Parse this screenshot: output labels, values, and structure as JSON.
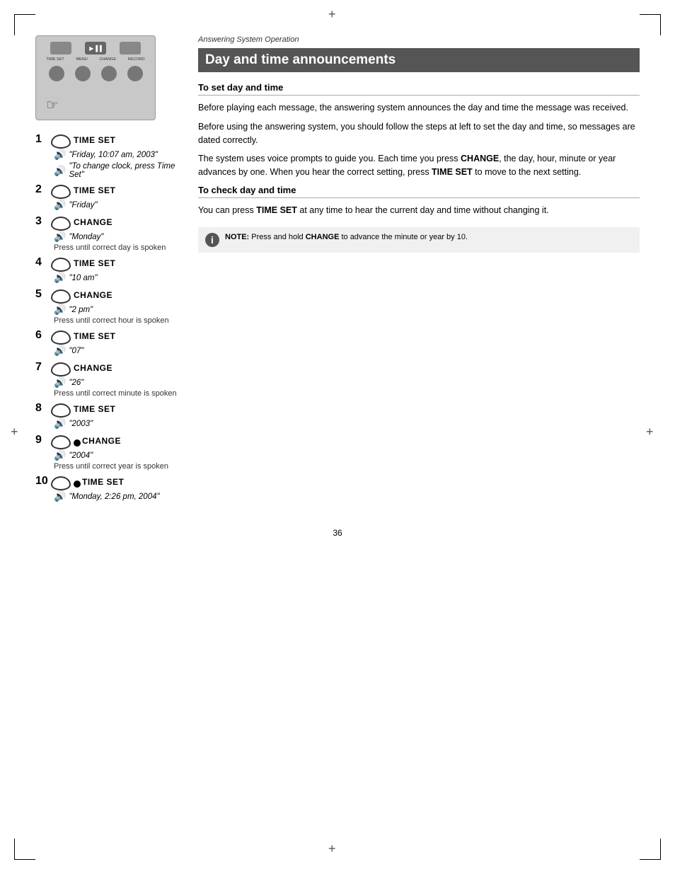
{
  "page": {
    "number": "36",
    "breadcrumb": "Answering System Operation"
  },
  "section": {
    "title": "Day and time announcements",
    "set_day_time_heading": "To set day and time",
    "check_day_time_heading": "To check day and time",
    "body1": "Before playing each message, the answering system announces the day and time the message was received.",
    "body2": "Before using the answering system, you should follow the steps at left to set the day and time, so messages are dated correctly.",
    "body3": "The system uses voice prompts to guide you. Each time you press CHANGE, the day, hour, minute or year advances by one. When you hear the correct setting, press TIME SET to move to the next setting.",
    "body4": "You can press TIME SET at any time to hear the current day and time without changing it.",
    "note_label": "NOTE:",
    "note_text": "Press and hold CHANGE to advance the minute or year by 10."
  },
  "steps": [
    {
      "number": "1",
      "action": "TIME SET",
      "has_bullet": false,
      "voice_lines": [
        "\"Friday, 10:07 am, 2003\"",
        "\"To change clock, press Time Set\""
      ],
      "note": ""
    },
    {
      "number": "2",
      "action": "TIME SET",
      "has_bullet": false,
      "voice_lines": [
        "\"Friday\""
      ],
      "note": ""
    },
    {
      "number": "3",
      "action": "CHANGE",
      "has_bullet": false,
      "voice_lines": [
        "\"Monday\""
      ],
      "note": "Press until correct day is spoken"
    },
    {
      "number": "4",
      "action": "TIME SET",
      "has_bullet": false,
      "voice_lines": [
        "\"10 am\""
      ],
      "note": ""
    },
    {
      "number": "5",
      "action": "CHANGE",
      "has_bullet": false,
      "voice_lines": [
        "\"2 pm\""
      ],
      "note": "Press until correct hour is spoken"
    },
    {
      "number": "6",
      "action": "TIME SET",
      "has_bullet": false,
      "voice_lines": [
        "\"07\""
      ],
      "note": ""
    },
    {
      "number": "7",
      "action": "CHANGE",
      "has_bullet": false,
      "voice_lines": [
        "\"26\""
      ],
      "note": "Press until correct minute is spoken"
    },
    {
      "number": "8",
      "action": "TIME SET",
      "has_bullet": false,
      "voice_lines": [
        "\"2003\""
      ],
      "note": ""
    },
    {
      "number": "9",
      "action": "CHANGE",
      "has_bullet": true,
      "voice_lines": [
        "\"2004\""
      ],
      "note": "Press until correct year is spoken"
    },
    {
      "number": "10",
      "action": "TIME SET",
      "has_bullet": true,
      "voice_lines": [
        "\"Monday, 2:26 pm, 2004\""
      ],
      "note": ""
    }
  ]
}
